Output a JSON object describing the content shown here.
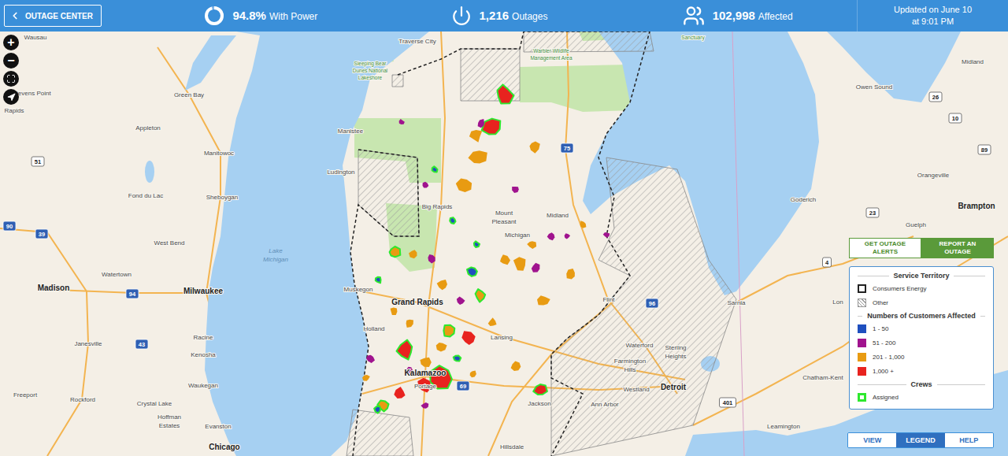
{
  "header": {
    "back_button": "OUTAGE CENTER",
    "stats": [
      {
        "value": "94.8%",
        "label": "With Power",
        "kind": "donut",
        "level": 0.948
      },
      {
        "value": "1,216",
        "label": "Outages",
        "kind": "power"
      },
      {
        "value": "102,998",
        "label": "Affected",
        "kind": "users"
      }
    ],
    "updated": [
      "Updated on June 10",
      "at 9:01 PM"
    ]
  },
  "map_controls": [
    {
      "kind": "zoom-in",
      "label": "+"
    },
    {
      "kind": "zoom-out",
      "label": "−"
    },
    {
      "kind": "fullscreen"
    },
    {
      "kind": "locate"
    }
  ],
  "actions": [
    {
      "label": "GET OUTAGE ALERTS",
      "selected": false
    },
    {
      "label": "REPORT AN OUTAGE",
      "selected": true
    }
  ],
  "legend": {
    "service_title": "Service Territory",
    "territories": [
      {
        "label": "Consumers Energy",
        "kind": "dashed"
      },
      {
        "label": "Other",
        "kind": "hatched"
      }
    ],
    "affected_title": "Numbers of Customers Affected",
    "ranges": [
      {
        "label": "1 - 50",
        "color": "#1f4fbf"
      },
      {
        "label": "51 - 200",
        "color": "#a0138e"
      },
      {
        "label": "201 - 1,000",
        "color": "#e89b12"
      },
      {
        "label": "1,000 +",
        "color": "#e8231f"
      }
    ],
    "crews_title": "Crews",
    "crews": [
      {
        "label": "Assigned",
        "color": "#2ee82e"
      }
    ]
  },
  "bottom_tabs": [
    {
      "label": "VIEW",
      "selected": false
    },
    {
      "label": "LEGEND",
      "selected": true
    },
    {
      "label": "HELP",
      "selected": false
    }
  ],
  "map": {
    "labels": [
      {
        "text": "Wausau",
        "kind": "city"
      },
      {
        "text": "Traverse City",
        "kind": "city"
      },
      {
        "text": "Sleeping Bear",
        "kind": "park"
      },
      {
        "text": "Dunes National",
        "kind": "park"
      },
      {
        "text": "Lakeshore",
        "kind": "park"
      },
      {
        "text": "Warbler Wildlife",
        "kind": "park"
      },
      {
        "text": "Management Area",
        "kind": "park"
      },
      {
        "text": "Sanctuary",
        "kind": "park"
      },
      {
        "text": "Midland",
        "kind": "city"
      },
      {
        "text": "Owen Sound",
        "kind": "city"
      },
      {
        "text": "Stevens Point",
        "kind": "city"
      },
      {
        "text": "Green Bay",
        "kind": "city"
      },
      {
        "text": "Rapids",
        "kind": "city"
      },
      {
        "text": "Appleton",
        "kind": "city"
      },
      {
        "text": "Manistee",
        "kind": "city"
      },
      {
        "text": "Manitowoc",
        "kind": "city"
      },
      {
        "text": "Fond du Lac",
        "kind": "city"
      },
      {
        "text": "Sheboygan",
        "kind": "city"
      },
      {
        "text": "Ludington",
        "kind": "city"
      },
      {
        "text": "Big Rapids",
        "kind": "city"
      },
      {
        "text": "Mount",
        "kind": "city"
      },
      {
        "text": "Pleasant",
        "kind": "city"
      },
      {
        "text": "Michigan",
        "kind": "city"
      },
      {
        "text": "Midland",
        "kind": "city"
      },
      {
        "text": "Goderich",
        "kind": "city"
      },
      {
        "text": "Orangeville",
        "kind": "city"
      },
      {
        "text": "Brampton",
        "kind": "major"
      },
      {
        "text": "Guelph",
        "kind": "city"
      },
      {
        "text": "West Bend",
        "kind": "city"
      },
      {
        "text": "Lake",
        "kind": "water"
      },
      {
        "text": "Michigan",
        "kind": "water"
      },
      {
        "text": "Watertown",
        "kind": "city"
      },
      {
        "text": "Madison",
        "kind": "major"
      },
      {
        "text": "Milwaukee",
        "kind": "major"
      },
      {
        "text": "Muskegon",
        "kind": "city"
      },
      {
        "text": "Grand Rapids",
        "kind": "major"
      },
      {
        "text": "Holland",
        "kind": "city"
      },
      {
        "text": "Lansing",
        "kind": "city"
      },
      {
        "text": "Flint",
        "kind": "city"
      },
      {
        "text": "Sarnia",
        "kind": "city"
      },
      {
        "text": "Lon",
        "kind": "city"
      },
      {
        "text": "Janesville",
        "kind": "city"
      },
      {
        "text": "Racine",
        "kind": "city"
      },
      {
        "text": "Kenosha",
        "kind": "city"
      },
      {
        "text": "Waukegan",
        "kind": "city"
      },
      {
        "text": "Freeport",
        "kind": "city"
      },
      {
        "text": "Rockford",
        "kind": "city"
      },
      {
        "text": "Crystal Lake",
        "kind": "city"
      },
      {
        "text": "Hoffman",
        "kind": "city"
      },
      {
        "text": "Estates",
        "kind": "city"
      },
      {
        "text": "Evanston",
        "kind": "city"
      },
      {
        "text": "Chicago",
        "kind": "major"
      },
      {
        "text": "Kalamazoo",
        "kind": "major"
      },
      {
        "text": "Portage",
        "kind": "city"
      },
      {
        "text": "Jackson",
        "kind": "city"
      },
      {
        "text": "Waterford",
        "kind": "city"
      },
      {
        "text": "Sterling",
        "kind": "city"
      },
      {
        "text": "Heights",
        "kind": "city"
      },
      {
        "text": "Farmington",
        "kind": "city"
      },
      {
        "text": "Hills",
        "kind": "city"
      },
      {
        "text": "Westland",
        "kind": "city"
      },
      {
        "text": "Detroit",
        "kind": "major"
      },
      {
        "text": "Ann Arbor",
        "kind": "city"
      },
      {
        "text": "Chatham-Kent",
        "kind": "city"
      },
      {
        "text": "Leamington",
        "kind": "city"
      },
      {
        "text": "Hillsdale",
        "kind": "city"
      }
    ],
    "shields": [
      {
        "text": "51",
        "kind": "highway"
      },
      {
        "text": "39",
        "kind": "interstate"
      },
      {
        "text": "94",
        "kind": "interstate"
      },
      {
        "text": "43",
        "kind": "interstate"
      },
      {
        "text": "90",
        "kind": "interstate"
      },
      {
        "text": "75",
        "kind": "interstate"
      },
      {
        "text": "96",
        "kind": "interstate"
      },
      {
        "text": "69",
        "kind": "interstate"
      },
      {
        "text": "23",
        "kind": "highway"
      },
      {
        "text": "26",
        "kind": "highway"
      },
      {
        "text": "89",
        "kind": "highway"
      },
      {
        "text": "10",
        "kind": "highway"
      },
      {
        "text": "4",
        "kind": "highway"
      },
      {
        "text": "401",
        "kind": "highway"
      }
    ],
    "outages": [
      {
        "range": "1,000 +",
        "crew": true
      },
      {
        "range": "1,000 +",
        "crew": true
      },
      {
        "range": "201 - 1,000",
        "crew": false
      },
      {
        "range": "201 - 1,000",
        "crew": false
      },
      {
        "range": "201 - 1,000",
        "crew": false
      },
      {
        "range": "201 - 1,000",
        "crew": false
      },
      {
        "range": "51 - 200",
        "crew": false
      },
      {
        "range": "51 - 200",
        "crew": false
      },
      {
        "range": "1 - 50",
        "crew": true
      },
      {
        "range": "51 - 200",
        "crew": false
      },
      {
        "range": "51 - 200",
        "crew": false
      },
      {
        "range": "1 - 50",
        "crew": true
      },
      {
        "range": "201 - 1,000",
        "crew": true
      },
      {
        "range": "201 - 1,000",
        "crew": false
      },
      {
        "range": "51 - 200",
        "crew": false
      },
      {
        "range": "201 - 1,000",
        "crew": false
      },
      {
        "range": "1 - 50",
        "crew": true
      },
      {
        "range": "201 - 1,000",
        "crew": false
      },
      {
        "range": "201 - 1,000",
        "crew": false
      },
      {
        "range": "51 - 200",
        "crew": false
      },
      {
        "range": "51 - 200",
        "crew": false
      },
      {
        "range": "201 - 1,000",
        "crew": false
      },
      {
        "range": "201 - 1,000",
        "crew": false
      },
      {
        "range": "201 - 1,000",
        "crew": false
      },
      {
        "range": "201 - 1,000",
        "crew": true
      },
      {
        "range": "51 - 200",
        "crew": false
      },
      {
        "range": "1 - 50",
        "crew": true
      },
      {
        "range": "201 - 1,000",
        "crew": false
      },
      {
        "range": "201 - 1,000",
        "crew": false
      },
      {
        "range": "1,000 +",
        "crew": true
      },
      {
        "range": "201 - 1,000",
        "crew": true
      },
      {
        "range": "1,000 +",
        "crew": false
      },
      {
        "range": "201 - 1,000",
        "crew": false
      },
      {
        "range": "1 - 50",
        "crew": true
      },
      {
        "range": "201 - 1,000",
        "crew": false
      },
      {
        "range": "1,000 +",
        "crew": true
      },
      {
        "range": "1,000 +",
        "crew": false
      },
      {
        "range": "1,000 +",
        "crew": false
      },
      {
        "range": "51 - 200",
        "crew": false
      },
      {
        "range": "201 - 1,000",
        "crew": false
      },
      {
        "range": "201 - 1,000",
        "crew": true
      },
      {
        "range": "1 - 50",
        "crew": true
      },
      {
        "range": "51 - 200",
        "crew": false
      },
      {
        "range": "201 - 1,000",
        "crew": false
      },
      {
        "range": "201 - 1,000",
        "crew": false
      },
      {
        "range": "1,000 +",
        "crew": true
      },
      {
        "range": "201 - 1,000",
        "crew": false
      },
      {
        "range": "51 - 200",
        "crew": false
      },
      {
        "range": "51 - 200",
        "crew": false
      },
      {
        "range": "201 - 1,000",
        "crew": false
      },
      {
        "range": "51 - 200",
        "crew": false
      },
      {
        "range": "1 - 50",
        "crew": true
      }
    ]
  }
}
